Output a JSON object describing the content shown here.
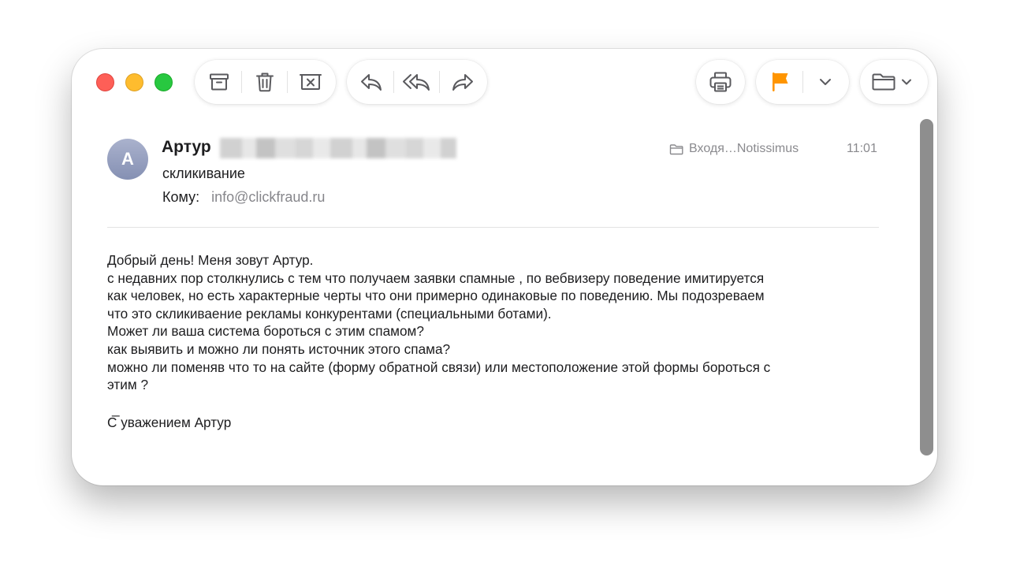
{
  "toolbar": {
    "archive_icon": "archive-icon",
    "trash_icon": "trash-icon",
    "junk_icon": "junk-icon",
    "reply_icon": "reply-icon",
    "reply_all_icon": "reply-all-icon",
    "forward_icon": "forward-icon",
    "print_icon": "print-icon",
    "flag_icon": "flag-icon",
    "flag_color": "#ff9500",
    "folder_icon": "folder-icon"
  },
  "message": {
    "avatar_initial": "A",
    "sender_name": "Артур",
    "subject": "скликивание",
    "to_label": "Кому:",
    "to_address": "info@clickfraud.ru",
    "mailbox": "Входя…Notissimus",
    "time": "11:01"
  },
  "body": {
    "lines": [
      "Добрый день! Меня зовут Артур.",
      "с недавних пор столкнулись с тем что получаем заявки спамные , по вебвизеру поведение имитируется",
      "как человек, но есть характерные черты что они примерно одинаковые по поведению.  Мы подозреваем",
      "что это скликиваение рекламы конкурентами (специальными ботами).",
      "Может ли ваша система бороться с этим спамом?",
      "как выявить и можно ли понять источник этого спама?",
      "можно ли поменяв что то на сайте (форму обратной связи) или местоположение этой формы бороться с",
      "этим ?"
    ],
    "signature_dash": "_",
    "signature": "С уважением Артур"
  }
}
